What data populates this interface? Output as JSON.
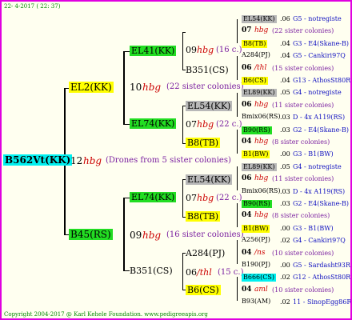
{
  "header": {
    "date": "22- 4-2017 ( 22: 37)"
  },
  "root": {
    "name": "B562Vt(KK)",
    "year": "12",
    "hbg": "hbg",
    "note": "(Drones from 5 sister colonies)"
  },
  "g1": {
    "sire": "EL2(KK)",
    "sire_year": "10",
    "sire_hbg": "hbg",
    "sire_note": "(22 sister colonies)",
    "dam": "B45(RS)",
    "dam_year": "09",
    "dam_hbg": "hbg",
    "dam_note": "(16 sister colonies)"
  },
  "g2": {
    "a": "EL41(KK)",
    "b": "EL74(KK)",
    "c": "EL74(KK)",
    "d": "B351(CS)"
  },
  "g2info": {
    "a_year": "09",
    "a_hbg": "hbg",
    "a_note": "(16 c.)",
    "a_sire": "B351(CS)",
    "b_top": "EL54(KK)",
    "b_year": "07",
    "b_hbg": "hbg",
    "b_note": "(22 c.)",
    "b_bot": "B8(TB)",
    "c_top": "EL54(KK)",
    "c_year": "07",
    "c_hbg": "hbg",
    "c_note": "(22 c.)",
    "c_bot": "B8(TB)",
    "d_top": "A284(PJ)",
    "d_year": "06",
    "d_hbg": "/thl",
    "d_note": "(15 c.)",
    "d_bot": "B6(CS)"
  },
  "g3": [
    {
      "name": "EL54(KK)",
      "style": "gray",
      "extra": ".06",
      "info": "G5 - notregiste"
    },
    {
      "name": "07",
      "hbg": "hbg",
      "note": "(22 sister colonies)"
    },
    {
      "name": "B8(TB)",
      "style": "yellow",
      "extra": ".04",
      "info": "G3 - E4(Skane-B)"
    },
    {
      "name": "A284(PJ)",
      "extra": ".04",
      "info": "G5 - Cankiri97Q"
    },
    {
      "name": "06",
      "hbg": "/thl",
      "note": "(15 sister colonies)"
    },
    {
      "name": "B6(CS)",
      "style": "yellow",
      "extra": ".04",
      "info": "G13 - AthosSt80R"
    },
    {
      "name": "EL89(KK)",
      "style": "gray",
      "extra": ".05",
      "info": "G4 - notregiste"
    },
    {
      "name": "06",
      "hbg": "hbg",
      "note": "(11 sister colonies)"
    },
    {
      "name": "Bmix06(RS)",
      "extra": ".03",
      "info": "D - 4x A119(RS)"
    },
    {
      "name": "B90(RS)",
      "style": "green",
      "extra": ".03",
      "info": "G2 - E4(Skane-B)"
    },
    {
      "name": "04",
      "hbg": "hbg",
      "note": "(8 sister colonies)"
    },
    {
      "name": "B1(BW)",
      "style": "yellow",
      "extra": ".00",
      "info": "G3 - B1(BW)"
    },
    {
      "name": "EL89(KK)",
      "style": "gray",
      "extra": ".05",
      "info": "G4 - notregiste"
    },
    {
      "name": "06",
      "hbg": "hbg",
      "note": "(11 sister colonies)"
    },
    {
      "name": "Bmix06(RS)",
      "extra": ".03",
      "info": "D - 4x A119(RS)"
    },
    {
      "name": "B90(RS)",
      "style": "green",
      "extra": ".03",
      "info": "G2 - E4(Skane-B)"
    },
    {
      "name": "04",
      "hbg": "hbg",
      "note": "(8 sister colonies)"
    },
    {
      "name": "B1(BW)",
      "style": "yellow",
      "extra": ".00",
      "info": "G3 - B1(BW)"
    },
    {
      "name": "A256(PJ)",
      "extra": ".02",
      "info": "G4 - Cankiri97Q"
    },
    {
      "name": "04",
      "hbg": "/ns",
      "note": "(10 sister colonies)"
    },
    {
      "name": "B190(PJ)",
      "extra": ".00",
      "info": "G5 - Sardasht93R"
    },
    {
      "name": "B666(CS)",
      "style": "cyan",
      "extra": ".02",
      "info": "G12 - AthosSt80R"
    },
    {
      "name": "04",
      "hbg": "aml",
      "note": "(10 sister colonies)"
    },
    {
      "name": "B93(AM)",
      "extra": ".02",
      "info": "11 - SinopEgg86R"
    }
  ],
  "footer": {
    "copyright": "Copyright 2004-2017 @ Karl Kehele Foundation.   www.pedigreeapis.org"
  }
}
